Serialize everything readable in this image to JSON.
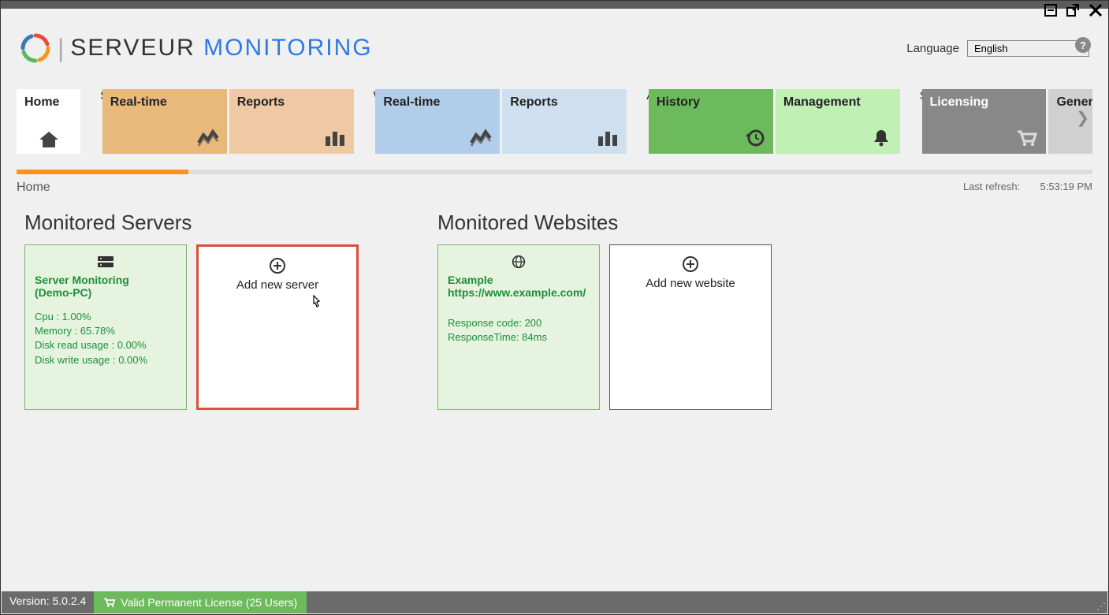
{
  "window": {
    "help": "?"
  },
  "header": {
    "brand": {
      "serv": "SERVEUR",
      "mon": "MONITORING"
    },
    "language_label": "Language",
    "language_value": "English"
  },
  "nav": {
    "home": "Home",
    "groups": {
      "a": {
        "label": "Servers",
        "tiles": [
          "Real-time",
          "Reports"
        ]
      },
      "b": {
        "label": "Websites",
        "tiles": [
          "Real-time",
          "Reports"
        ]
      },
      "c": {
        "label": "Alerts",
        "tiles": [
          "History",
          "Management"
        ]
      },
      "d": {
        "label": "Settings",
        "tiles": [
          "Licensing",
          "General"
        ]
      }
    }
  },
  "breadcrumb": {
    "path": "Home",
    "last_refresh_label": "Last refresh:",
    "last_refresh_time": "5:53:19 PM"
  },
  "main": {
    "servers": {
      "title": "Monitored Servers",
      "card": {
        "name": "Server Monitoring",
        "host": "(Demo-PC)",
        "cpu": "Cpu : 1.00%",
        "mem": "Memory : 65.78%",
        "dr": "Disk read usage : 0.00%",
        "dw": "Disk write usage : 0.00%"
      },
      "add": "Add new server"
    },
    "websites": {
      "title": "Monitored Websites",
      "card": {
        "name": "Example",
        "url": "https://www.example.com/",
        "resp": "Response code: 200",
        "time": "ResponseTime: 84ms"
      },
      "add": "Add new website"
    }
  },
  "status": {
    "version": "Version: 5.0.2.4",
    "license": "Valid Permanent License (25 Users)"
  }
}
